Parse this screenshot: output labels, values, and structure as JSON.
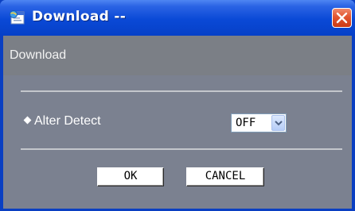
{
  "window": {
    "title": "Download --",
    "icons": {
      "app": "browser-page-icon",
      "close": "close-icon"
    }
  },
  "header": {
    "title": "Download"
  },
  "form": {
    "alter_detect_label": "Alter Detect",
    "alter_detect_value": "OFF"
  },
  "buttons": {
    "ok": "OK",
    "cancel": "CANCEL"
  },
  "colors": {
    "titlebar": "#0a49d6",
    "client_bg": "#7b8190",
    "header_bg": "#7b7f86",
    "close_button": "#e25530"
  }
}
